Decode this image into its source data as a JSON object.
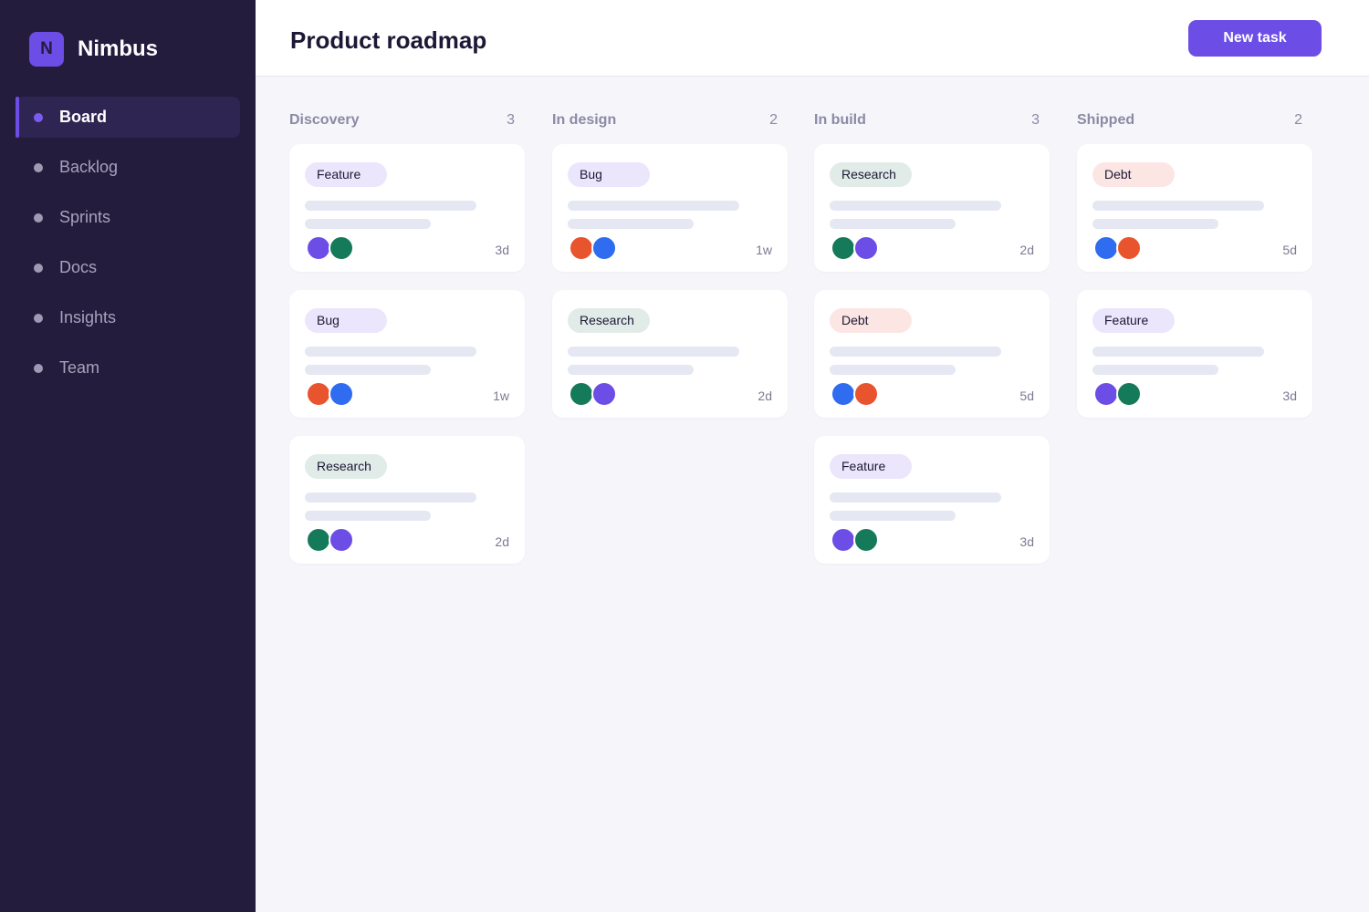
{
  "sidebar": {
    "brand_initial": "N",
    "brand_name": "Nimbus",
    "items": [
      {
        "label": "Board",
        "active": true
      },
      {
        "label": "Backlog",
        "active": false
      },
      {
        "label": "Sprints",
        "active": false
      },
      {
        "label": "Docs",
        "active": false
      },
      {
        "label": "Insights",
        "active": false
      },
      {
        "label": "Team",
        "active": false
      }
    ]
  },
  "header": {
    "title": "Product roadmap",
    "new_task_label": "New task"
  },
  "colors": {
    "accent": "#6c4de6",
    "sidebar_bg": "#231c3d",
    "avatar_purple": "#6c4de6",
    "avatar_green": "#157a5a",
    "avatar_orange": "#e8542d",
    "avatar_blue": "#2f6cf0"
  },
  "board": {
    "columns": [
      {
        "title": "Discovery",
        "count": "3",
        "cards": [
          {
            "tag": "Feature",
            "due": "3d",
            "avatars": [
              "#6c4de6",
              "#157a5a"
            ]
          },
          {
            "tag": "Bug",
            "due": "1w",
            "avatars": [
              "#e8542d",
              "#2f6cf0"
            ]
          },
          {
            "tag": "Research",
            "due": "2d",
            "avatars": [
              "#157a5a",
              "#6c4de6"
            ]
          }
        ]
      },
      {
        "title": "In design",
        "count": "2",
        "cards": [
          {
            "tag": "Bug",
            "due": "1w",
            "avatars": [
              "#e8542d",
              "#2f6cf0"
            ]
          },
          {
            "tag": "Research",
            "due": "2d",
            "avatars": [
              "#157a5a",
              "#6c4de6"
            ]
          }
        ]
      },
      {
        "title": "In build",
        "count": "3",
        "cards": [
          {
            "tag": "Research",
            "due": "2d",
            "avatars": [
              "#157a5a",
              "#6c4de6"
            ]
          },
          {
            "tag": "Debt",
            "due": "5d",
            "avatars": [
              "#2f6cf0",
              "#e8542d"
            ]
          },
          {
            "tag": "Feature",
            "due": "3d",
            "avatars": [
              "#6c4de6",
              "#157a5a"
            ]
          }
        ]
      },
      {
        "title": "Shipped",
        "count": "2",
        "cards": [
          {
            "tag": "Debt",
            "due": "5d",
            "avatars": [
              "#2f6cf0",
              "#e8542d"
            ]
          },
          {
            "tag": "Feature",
            "due": "3d",
            "avatars": [
              "#6c4de6",
              "#157a5a"
            ]
          }
        ]
      }
    ]
  }
}
